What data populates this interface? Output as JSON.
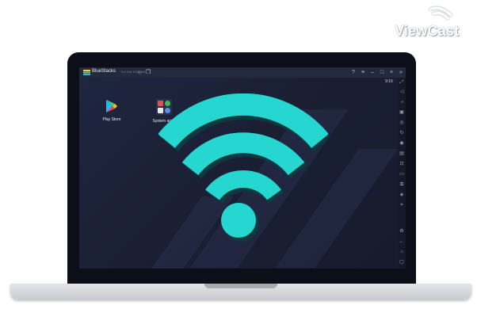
{
  "watermark": {
    "text": "ViewCast"
  },
  "window": {
    "app_name": "BlueStacks",
    "version": "5.6.100.1026 N64"
  },
  "titlebar_icons": [
    "home-icon",
    "multi-instance-icon",
    "help-icon",
    "menu-icon",
    "minimize-icon",
    "maximize-icon",
    "close-icon",
    "expand-icon"
  ],
  "status": {
    "time": "9:16"
  },
  "desktop": {
    "apps": [
      {
        "label": "Play Store",
        "icon": "play-store-icon"
      },
      {
        "label": "System apps",
        "icon": "system-apps-icon"
      }
    ]
  },
  "sidebar_icons": [
    "fullscreen-icon",
    "volume-up-icon",
    "volume-down-icon",
    "media-icon",
    "screenshot-icon",
    "rotate-icon",
    "controls-icon",
    "macro-icon",
    "screen-record-icon",
    "folder-icon",
    "multi-instance-manager-icon",
    "layers-icon",
    "location-icon",
    "settings-icon",
    "back-icon",
    "home-icon",
    "recent-apps-icon"
  ],
  "colors": {
    "wifi": "#26d6d0",
    "wifi_shadow": "#0b3b3f",
    "screen_bg": "#1b2034",
    "bezel": "#0c0f17"
  },
  "overlay_icon": "wifi-icon"
}
